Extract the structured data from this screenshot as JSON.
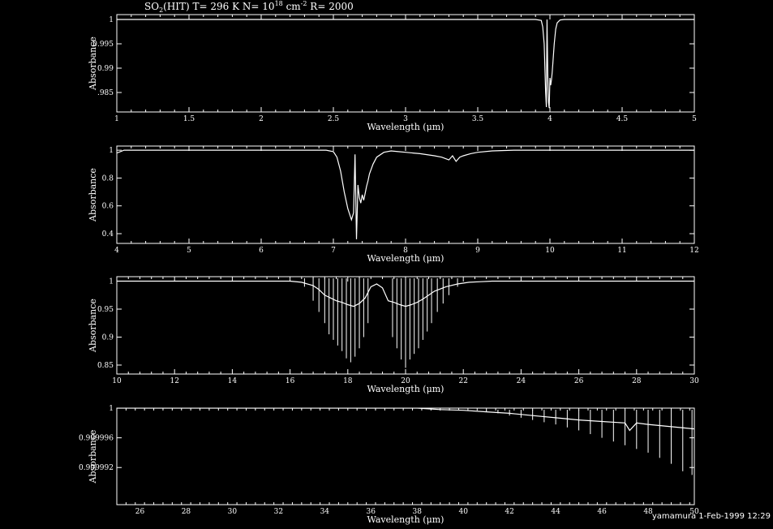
{
  "title": {
    "prefix": "SO",
    "sub": "2",
    "rest": "(HIT) T= 296 K N= 10",
    "sup": "18",
    "units": " cm",
    "units_sup": "-2",
    "res": " R= 2000"
  },
  "footer": "yamamura  1-Feb-1999 12:29",
  "colors": {
    "background": "#000000",
    "foreground": "#ffffff"
  },
  "chart_data": [
    {
      "type": "line",
      "xlabel": "Wavelength (μm)",
      "ylabel": "Absorbance",
      "xlim": [
        1,
        5
      ],
      "ylim": [
        0.981,
        1.001
      ],
      "xticks": [
        1,
        1.5,
        2,
        2.5,
        3,
        3.5,
        4,
        4.5,
        5
      ],
      "xtick_labels": [
        "1",
        "1.5",
        "2",
        "2.5",
        "3",
        "3.5",
        "4",
        "4.5",
        "5"
      ],
      "yticks": [
        0.985,
        0.99,
        0.995,
        1
      ],
      "ytick_labels": [
        ".985",
        "0.99",
        "0.995",
        "1"
      ],
      "series": [
        {
          "x": [
            1.0,
            3.8,
            3.9,
            3.94,
            3.95,
            3.96,
            3.97,
            3.975,
            3.98,
            3.985,
            3.99,
            3.995,
            4.0,
            4.005,
            4.01,
            4.015,
            4.02,
            4.03,
            4.04,
            4.05,
            4.07,
            4.1,
            4.2,
            5.0
          ],
          "y": [
            1.0,
            1.0,
            1.0,
            0.9998,
            0.9985,
            0.995,
            0.985,
            0.982,
            1.0,
            0.989,
            0.983,
            0.9818,
            0.988,
            0.9865,
            0.9875,
            0.989,
            0.991,
            0.995,
            0.998,
            0.9993,
            0.9999,
            1.0,
            1.0,
            1.0
          ]
        }
      ]
    },
    {
      "type": "line",
      "xlabel": "Wavelength (μm)",
      "ylabel": "Absorbance",
      "xlim": [
        4,
        12
      ],
      "ylim": [
        0.33,
        1.03
      ],
      "xticks": [
        4,
        5,
        6,
        7,
        8,
        9,
        10,
        11,
        12
      ],
      "xtick_labels": [
        "4",
        "5",
        "6",
        "7",
        "8",
        "9",
        "10",
        "11",
        "12"
      ],
      "yticks": [
        0.4,
        0.6,
        0.8,
        1
      ],
      "ytick_labels": [
        "0.4",
        "0.6",
        "0.8",
        "1"
      ],
      "series": [
        {
          "x": [
            4.0,
            4.05,
            4.1,
            6.9,
            7.0,
            7.05,
            7.1,
            7.15,
            7.2,
            7.25,
            7.28,
            7.3,
            7.32,
            7.34,
            7.36,
            7.38,
            7.4,
            7.42,
            7.44,
            7.46,
            7.48,
            7.5,
            7.55,
            7.6,
            7.7,
            7.8,
            7.9,
            8.0,
            8.2,
            8.4,
            8.5,
            8.6,
            8.65,
            8.7,
            8.75,
            8.8,
            8.9,
            9.0,
            9.2,
            9.5,
            12.0
          ],
          "y": [
            0.98,
            0.99,
            1.0,
            1.0,
            0.99,
            0.95,
            0.85,
            0.7,
            0.58,
            0.5,
            0.55,
            0.97,
            0.36,
            0.75,
            0.66,
            0.62,
            0.68,
            0.64,
            0.69,
            0.74,
            0.78,
            0.83,
            0.9,
            0.95,
            0.985,
            0.995,
            0.99,
            0.985,
            0.975,
            0.96,
            0.95,
            0.93,
            0.96,
            0.92,
            0.95,
            0.96,
            0.975,
            0.985,
            0.995,
            1.0,
            1.0
          ]
        }
      ]
    },
    {
      "type": "line",
      "xlabel": "Wavelength (μm)",
      "ylabel": "Absorbance",
      "xlim": [
        10,
        30
      ],
      "ylim": [
        0.834,
        1.008
      ],
      "xticks": [
        10,
        12,
        14,
        16,
        18,
        20,
        22,
        24,
        26,
        28,
        30
      ],
      "xtick_labels": [
        "10",
        "12",
        "14",
        "16",
        "18",
        "20",
        "22",
        "24",
        "26",
        "28",
        "30"
      ],
      "yticks": [
        0.85,
        0.9,
        0.95,
        1
      ],
      "ytick_labels": [
        "0.85",
        "0.9",
        "0.95",
        "1"
      ],
      "series": [
        {
          "x": [
            10.0,
            16.0,
            16.4,
            16.8,
            17.0,
            17.2,
            17.4,
            17.6,
            17.8,
            18.0,
            18.2,
            18.4,
            18.6,
            18.8,
            19.0,
            19.2,
            19.4,
            19.6,
            19.8,
            20.0,
            20.2,
            20.4,
            20.6,
            20.8,
            21.0,
            21.4,
            21.8,
            22.2,
            22.6,
            23.0,
            30.0
          ],
          "y": [
            1.0,
            1.0,
            0.998,
            0.992,
            0.985,
            0.975,
            0.97,
            0.965,
            0.962,
            0.958,
            0.955,
            0.96,
            0.97,
            0.99,
            0.995,
            0.988,
            0.965,
            0.962,
            0.958,
            0.955,
            0.958,
            0.962,
            0.968,
            0.975,
            0.982,
            0.99,
            0.995,
            0.998,
            0.999,
            1.0,
            1.0
          ]
        }
      ],
      "lines": {
        "x": [
          16.5,
          16.8,
          17.0,
          17.2,
          17.35,
          17.5,
          17.65,
          17.8,
          17.95,
          18.1,
          18.25,
          18.4,
          18.55,
          18.7,
          19.55,
          19.7,
          19.85,
          20.0,
          20.15,
          20.3,
          20.45,
          20.6,
          20.75,
          20.9,
          21.1,
          21.3,
          21.5,
          21.8
        ],
        "depth": [
          0.99,
          0.965,
          0.945,
          0.925,
          0.905,
          0.895,
          0.885,
          0.875,
          0.862,
          0.855,
          0.865,
          0.88,
          0.9,
          0.925,
          0.9,
          0.88,
          0.86,
          0.845,
          0.86,
          0.87,
          0.88,
          0.895,
          0.91,
          0.925,
          0.945,
          0.96,
          0.975,
          0.99
        ]
      }
    },
    {
      "type": "line",
      "xlabel": "Wavelength (μm)",
      "ylabel": "Absorbance",
      "xlim": [
        25,
        50
      ],
      "ylim": [
        0.99987,
        1.0
      ],
      "xticks": [
        26,
        28,
        30,
        32,
        34,
        36,
        38,
        40,
        42,
        44,
        46,
        48,
        50
      ],
      "xtick_labels": [
        "26",
        "28",
        "30",
        "32",
        "34",
        "36",
        "38",
        "40",
        "42",
        "44",
        "46",
        "48",
        "50"
      ],
      "yticks": [
        0.99992,
        0.99996,
        1
      ],
      "ytick_labels": [
        "0.999992",
        "0.999996",
        "1"
      ],
      "series": [
        {
          "x": [
            25.0,
            37.0,
            38.0,
            39.0,
            40.0,
            41.0,
            42.0,
            43.0,
            44.0,
            45.0,
            46.0,
            47.0,
            47.2,
            47.5,
            48.0,
            49.0,
            50.0
          ],
          "y": [
            1.0,
            1.0,
            1.0,
            0.999998,
            0.999997,
            0.999995,
            0.999993,
            0.99999,
            0.999987,
            0.999984,
            0.999982,
            0.99998,
            0.99997,
            0.99998,
            0.999978,
            0.999975,
            0.999972
          ]
        }
      ],
      "lines": {
        "x": [
          41.0,
          41.5,
          42.0,
          42.5,
          43.0,
          43.5,
          44.0,
          44.5,
          45.0,
          45.5,
          46.0,
          46.5,
          47.0,
          47.5,
          48.0,
          48.5,
          49.0,
          49.5,
          49.9
        ],
        "depth": [
          0.999995,
          0.999993,
          0.99999,
          0.999987,
          0.999984,
          0.999981,
          0.999978,
          0.999974,
          0.99997,
          0.999965,
          0.99996,
          0.999955,
          0.99995,
          0.999945,
          0.99994,
          0.999933,
          0.999925,
          0.999915,
          0.99991
        ]
      }
    }
  ]
}
